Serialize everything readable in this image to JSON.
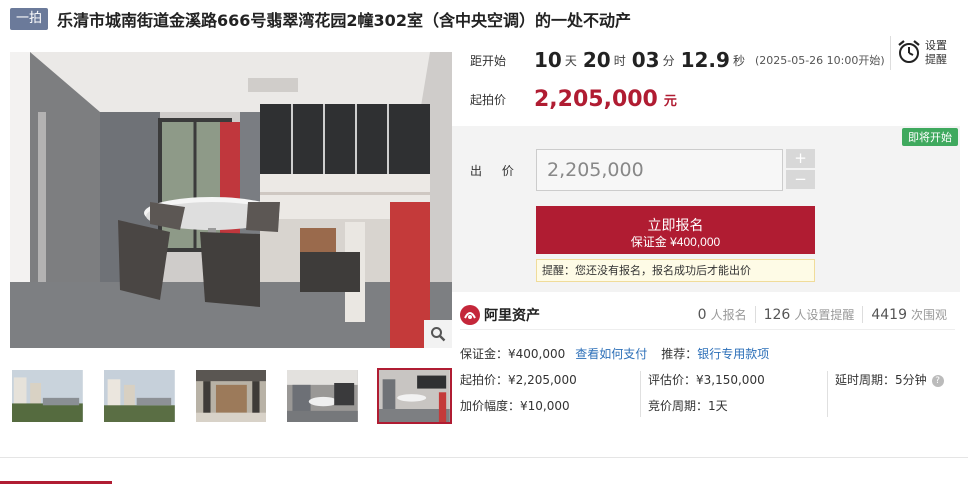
{
  "header": {
    "badge": "一拍",
    "title": "乐清市城南街道金溪路666号翡翠湾花园2幢302室（含中央空调）的一处不动产"
  },
  "countdown": {
    "label": "距开始",
    "days": "10",
    "days_unit": "天",
    "hours": "20",
    "hours_unit": "时",
    "minutes": "03",
    "minutes_unit": "分",
    "seconds": "12.9",
    "seconds_unit": "秒",
    "start_time": "(2025-05-26 10:00开始)"
  },
  "reminder": {
    "line1": "设置",
    "line2": "提醒",
    "icon": "alarm-clock-icon"
  },
  "start_price": {
    "label": "起拍价",
    "value": "2,205,000",
    "unit": "元"
  },
  "bid": {
    "status_tag": "即将开始",
    "label": "出 价",
    "input_value": "2,205,000",
    "plus": "+",
    "minus": "−",
    "signup_label": "立即报名",
    "deposit_label": "保证金 ¥400,000",
    "tip": "提醒：您还没有报名，报名成功后才能出价"
  },
  "platform": {
    "name": "阿里资产",
    "stats": [
      {
        "num": "0",
        "label": "人报名"
      },
      {
        "num": "126",
        "label": "人设置提醒"
      },
      {
        "num": "4419",
        "label": "次围观"
      }
    ]
  },
  "details": {
    "deposit": "保证金：¥400,000",
    "pay_link": "查看如何支付",
    "recommend_label": "推荐：",
    "recommend_link": "银行专用款项",
    "start_price": "起拍价：¥2,205,000",
    "increment": "加价幅度：¥10,000",
    "appraisal": "评估价：¥3,150,000",
    "cycle": "竞价周期：1天",
    "delay": "延时周期：5分钟",
    "help": "?"
  },
  "colors": {
    "accent": "#b01c32",
    "tag_green": "#3fa95e",
    "badge": "#6b7a9a",
    "link": "#2c6fb8"
  }
}
